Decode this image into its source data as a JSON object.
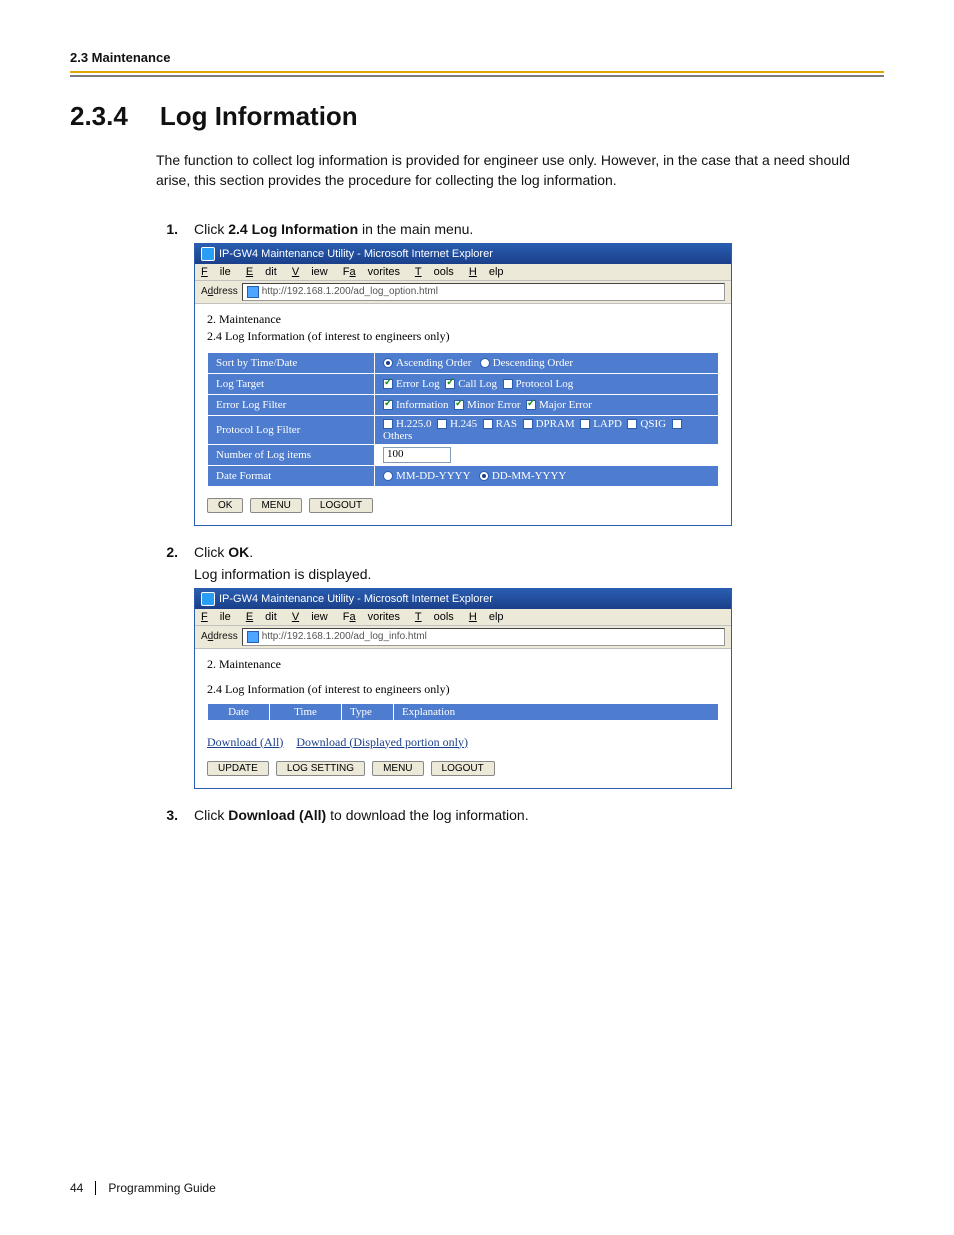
{
  "header": {
    "running": "2.3 Maintenance"
  },
  "heading": {
    "number": "2.3.4",
    "title": "Log Information"
  },
  "intro": "The function to collect log information is provided for engineer use only. However, in the case that a need should arise, this section provides the procedure for collecting the log information.",
  "steps": {
    "s1_pre": "Click ",
    "s1_bold": "2.4 Log Information",
    "s1_post": " in the main menu.",
    "s2_pre": "Click ",
    "s2_bold": "OK",
    "s2_post": ".",
    "s2_line2": "Log information is displayed.",
    "s3_pre": "Click ",
    "s3_bold": "Download (All)",
    "s3_post": " to download the log information."
  },
  "ie": {
    "title": "IP-GW4 Maintenance Utility - Microsoft Internet Explorer",
    "menu": {
      "file": "File",
      "edit": "Edit",
      "view": "View",
      "favorites": "Favorites",
      "tools": "Tools",
      "help": "Help"
    },
    "addr_label": "Address",
    "addr1": "http://192.168.1.200/ad_log_option.html",
    "addr2": "http://192.168.1.200/ad_log_info.html",
    "crumb1": "2. Maintenance",
    "crumb2": "2.4 Log Information (of interest to engineers only)",
    "rows": {
      "sort": "Sort by Time/Date",
      "sort_asc": "Ascending Order",
      "sort_desc": "Descending Order",
      "target": "Log Target",
      "target_err": "Error Log",
      "target_call": "Call Log",
      "target_proto": "Protocol Log",
      "errfilter": "Error Log Filter",
      "ef_info": "Information",
      "ef_minor": "Minor Error",
      "ef_major": "Major Error",
      "protofilter": "Protocol Log Filter",
      "pf_h2250": "H.225.0",
      "pf_h245": "H.245",
      "pf_ras": "RAS",
      "pf_dpram": "DPRAM",
      "pf_lapd": "LAPD",
      "pf_qsig": "QSIG",
      "pf_others": "Others",
      "nitems": "Number of Log items",
      "nitems_val": "100",
      "datefmt": "Date Format",
      "df_mdy": "MM-DD-YYYY",
      "df_dmy": "DD-MM-YYYY"
    },
    "buttons": {
      "ok": "OK",
      "menu": "MENU",
      "logout": "LOGOUT",
      "update": "UPDATE",
      "logsetting": "LOG SETTING"
    },
    "logcols": {
      "date": "Date",
      "time": "Time",
      "type": "Type",
      "expl": "Explanation"
    },
    "links": {
      "dl_all": "Download (All)",
      "dl_disp": "Download (Displayed portion only)"
    }
  },
  "footer": {
    "page": "44",
    "book": "Programming Guide"
  }
}
